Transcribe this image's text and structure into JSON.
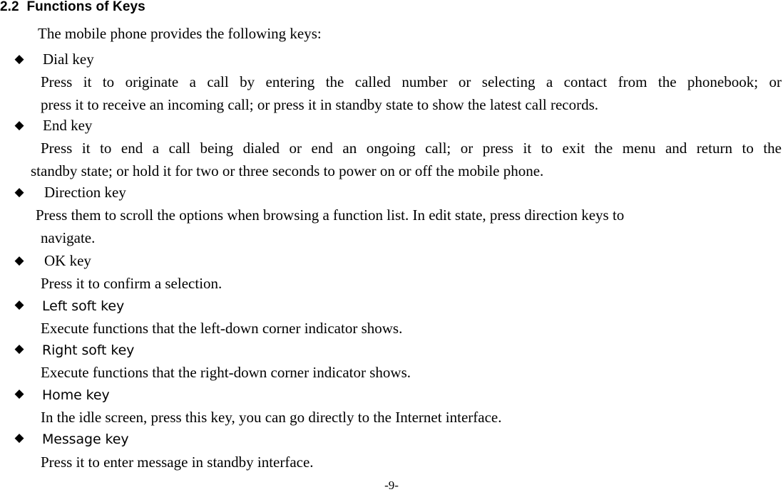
{
  "document": {
    "section_number": "2.2",
    "section_title": "Functions of Keys",
    "heading_full": "2.2  Functions of Keys",
    "intro": "The mobile phone provides the following keys:",
    "page_number_label": "-9-",
    "bullet_glyph": "◆"
  },
  "keys": [
    {
      "name": "Dial key",
      "font": "serif",
      "description_lines": [
        "Press it to originate a call by entering the called number or selecting a contact from the phonebook; or",
        "press it to receive an incoming call; or press it in standby state to show the latest call records."
      ],
      "description_full": "Press it to originate a call by entering the called number or selecting a contact from the phonebook; or press it to receive an incoming call; or press it in standby state to show the latest call records."
    },
    {
      "name": "End key",
      "font": "serif",
      "description_lines": [
        "Press it to end a call being dialed or end an ongoing call; or press it to exit the menu and return to the",
        "standby state; or hold it for two or three seconds to power on or off the mobile phone."
      ],
      "description_full": "Press it to end a call being dialed or end an ongoing call; or press it to exit the menu and return to the standby state; or hold it for two or three seconds to power on or off the mobile phone."
    },
    {
      "name": "Direction key",
      "font": "serif",
      "description_lines": [
        "Press them to scroll the options when browsing a function list. In edit state, press direction keys to",
        "navigate."
      ],
      "description_full": "Press them to scroll the options when browsing a function list. In edit state, press direction keys to navigate."
    },
    {
      "name": "OK key",
      "font": "serif",
      "description_lines": [
        "Press it to confirm a selection."
      ],
      "description_full": "Press it to confirm a selection."
    },
    {
      "name": "Left soft key",
      "font": "sans",
      "description_lines": [
        "Execute functions that the left-down corner indicator shows."
      ],
      "description_full": "Execute functions that the left-down corner indicator shows."
    },
    {
      "name": "Right soft key",
      "font": "sans",
      "description_lines": [
        "Execute functions that the right-down corner indicator shows."
      ],
      "description_full": "Execute functions that the right-down corner indicator shows."
    },
    {
      "name": "Home key",
      "font": "sans",
      "description_lines": [
        "In the idle screen, press this key, you can go directly to the Internet interface."
      ],
      "description_full": "In the idle screen, press this key, you can go directly to the Internet interface."
    },
    {
      "name": "Message key",
      "font": "sans",
      "description_lines": [
        "Press it to enter message in standby interface."
      ],
      "description_full": "Press it to enter message in standby interface."
    }
  ]
}
